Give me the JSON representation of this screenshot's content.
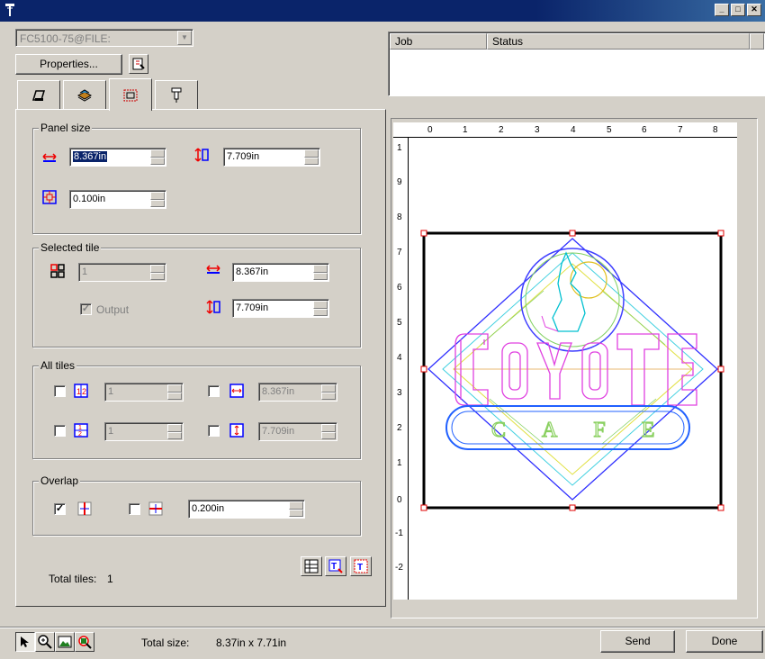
{
  "window": {
    "title": "",
    "buttons": [
      "_",
      "□",
      "X"
    ]
  },
  "device": {
    "selected": "FC5100-75@FILE:"
  },
  "toolbar": {
    "properties_label": "Properties..."
  },
  "tabs": [
    {
      "icon": "plotter-icon"
    },
    {
      "icon": "layers-icon"
    },
    {
      "icon": "tiling-icon",
      "active": true
    },
    {
      "icon": "blade-icon"
    }
  ],
  "panel_size": {
    "legend": "Panel size",
    "width": "8.367in",
    "height": "7.709in",
    "margin": "0.100in"
  },
  "selected_tile": {
    "legend": "Selected tile",
    "tile_number": "1",
    "width": "8.367in",
    "height": "7.709in",
    "output_label": "Output",
    "output_checked": true
  },
  "all_tiles": {
    "legend": "All tiles",
    "columns": "1",
    "rows": "1",
    "width": "8.367in",
    "height": "7.709in"
  },
  "overlap": {
    "legend": "Overlap",
    "horizontal_checked": true,
    "vertical_checked": false,
    "value": "0.200in"
  },
  "total_tiles": {
    "label": "Total tiles:",
    "value": "1"
  },
  "jobs": {
    "columns": [
      "Job",
      "Status"
    ]
  },
  "preview": {
    "ruler_h": [
      "0",
      "1",
      "2",
      "3",
      "4",
      "5",
      "6",
      "7",
      "8"
    ],
    "ruler_v": [
      "1",
      "9",
      "8",
      "7",
      "6",
      "5",
      "4",
      "3",
      "2",
      "1",
      "0",
      "-1",
      "-2"
    ],
    "logo_word": "COYOTE",
    "logo_sub": "CAFE",
    "colors": {
      "outer_border": "#000000",
      "diamond": "#3030ff",
      "letters": "#e040e0",
      "cafe_letters": "#8ad060",
      "oval": "#2060ff",
      "circle": "#4040ff",
      "handles": "#e00000"
    }
  },
  "status": {
    "total_size_label": "Total size:",
    "total_size_value": "8.37in x 7.71in",
    "send_label": "Send",
    "done_label": "Done"
  }
}
